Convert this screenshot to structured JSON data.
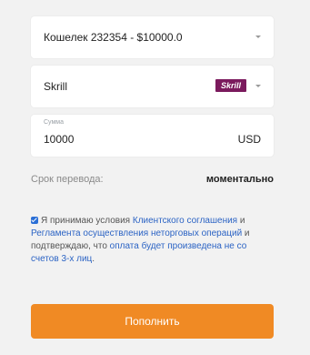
{
  "wallet_select": {
    "value": "Кошелек 232354 - $10000.0"
  },
  "method_select": {
    "value": "Skrill",
    "logo_text": "Skrill",
    "logo_color": "#7b1a5d"
  },
  "amount": {
    "label": "Сумма",
    "value": "10000",
    "currency": "USD"
  },
  "transfer_term": {
    "label": "Срок перевода:",
    "value": "моментально"
  },
  "agreement": {
    "checked": true,
    "part1": "Я принимаю условия ",
    "link1": "Клиентского соглашения",
    "part2": " и ",
    "link2": "Регламента осуществления неторговых операций",
    "part3": " и подтверждаю, что ",
    "link3": "оплата будет произведена не со счетов 3-х лиц",
    "part4": "."
  },
  "submit": {
    "label": "Пополнить",
    "color": "#f08a24"
  },
  "colors": {
    "link": "#2b63c4",
    "checkbox": "#2b6fd6",
    "background": "#f2f2f2"
  }
}
